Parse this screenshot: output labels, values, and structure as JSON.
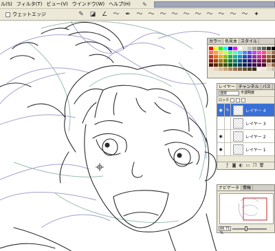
{
  "menubar": {
    "items": [
      "ル(S)",
      "フィルタ(T)",
      "ビュー(V)",
      "ウインドウ(W)",
      "ヘルプ(H)"
    ],
    "icon": "pencil-icon"
  },
  "options": {
    "snap_checkbox_checked": false,
    "snap_label": "ウェットエッジ",
    "icons": [
      "brush-tool-icon",
      "mode-icon",
      "angle-icon",
      "curve-icon",
      "pen-icon",
      "curve-icon",
      "curve-icon",
      "curve-icon",
      "curve-icon",
      "curve-icon",
      "curve-icon",
      "curve-icon",
      "curve-icon",
      "curve-icon",
      "curve-icon",
      "brush-preset-icon"
    ]
  },
  "swatch_panel": {
    "tabs": [
      "カラー",
      "色見本",
      "スタイル"
    ],
    "active_tab": 1,
    "colors": [
      "#ff0000",
      "#ffff00",
      "#00ff00",
      "#00ffff",
      "#0000ff",
      "#ff00ff",
      "#ffffff",
      "#e0e0e0",
      "#c0c0c0",
      "#a0a0a0",
      "#808080",
      "#606060",
      "#303030",
      "#000000",
      "#ff6a6a",
      "#ff9a4a",
      "#ffd24a",
      "#c8ff4a",
      "#4aff6a",
      "#4affc8",
      "#4ad2ff",
      "#4a8aff",
      "#6a4aff",
      "#b44aff",
      "#ff4ad2",
      "#ff4a8a",
      "#d8a080",
      "#a07050",
      "#d03030",
      "#e07020",
      "#e0b020",
      "#90c020",
      "#20b050",
      "#20b0a0",
      "#2090d0",
      "#2050c0",
      "#5030b0",
      "#9030b0",
      "#c030a0",
      "#c03060",
      "#a06040",
      "#704020",
      "#901818",
      "#a04810",
      "#a08010",
      "#608010",
      "#108030",
      "#108070",
      "#105890",
      "#103080",
      "#301880",
      "#601880",
      "#801870",
      "#801840",
      "#704020",
      "#402010",
      "#501010",
      "#602808",
      "#605008",
      "#405008",
      "#085018",
      "#085048",
      "#083858",
      "#081850",
      "#180850",
      "#380850",
      "#500848",
      "#500828",
      "#d0b090",
      "#906848",
      "#f0e0d0",
      "#e8d0b8",
      "#d8b898",
      "#c8a078",
      "#b08860",
      "#987050",
      "#806040",
      "#685030",
      "#504028",
      "#383020",
      "#f8f0e8",
      "#f0e8d8",
      "#e0d8c8",
      "#c8c0b0"
    ]
  },
  "layer_panel": {
    "tabs": [
      "レイヤー",
      "チャンネル",
      "パス"
    ],
    "active_tab": 0,
    "blend_mode": "通常",
    "protect_label": "不透明度",
    "lock_label": "ロック",
    "layers": [
      {
        "name": "レイヤー 4",
        "visible": true,
        "selected": true
      },
      {
        "name": "レイヤー 3",
        "visible": false,
        "selected": false
      },
      {
        "name": "レイヤー 2",
        "visible": true,
        "selected": false
      },
      {
        "name": "レイヤー 1",
        "visible": true,
        "selected": false
      }
    ],
    "toolbar_icons": [
      "link-icon",
      "effects-icon",
      "mask-icon",
      "adjustment-icon",
      "folder-icon",
      "new-layer-icon",
      "trash-icon"
    ]
  },
  "nav_panel": {
    "tabs": [
      "ナビゲータ",
      "情報"
    ],
    "active_tab": 0,
    "zoom": "66.71 %"
  },
  "colors": {
    "ui_bg": "#ece9d8",
    "selected_layer": "#3a6fd6",
    "line_art": "#2a2a2a",
    "sketch_purple": "#9b96cc",
    "sketch_green": "#8fb7a4",
    "navigator_box": "#cc2222"
  }
}
